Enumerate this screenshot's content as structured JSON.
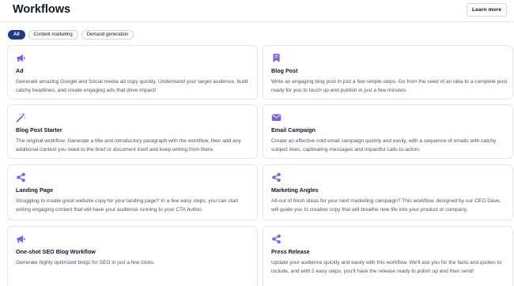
{
  "header": {
    "title": "Workflows",
    "learn_more": "Learn more"
  },
  "filters": [
    "All",
    "Content marketing",
    "Demand generation"
  ],
  "accent_color": "#7c5cf2",
  "workflows": [
    {
      "icon": "megaphone-icon",
      "title": "Ad",
      "description": "Generate amazing Google and Social media ad copy quickly. Understand your target audience, build catchy headlines, and create engaging ads that drive impact!"
    },
    {
      "icon": "bookmark-icon",
      "title": "Blog Post",
      "description": "Write an engaging blog post in just a few simple steps. Go from the seed of an idea to a complete post ready for you to touch up and publish in just a few minutes."
    },
    {
      "icon": "magic-wand-icon",
      "title": "Blog Post Starter",
      "description": "The original workflow. Generate a title and introductory paragraph with the workflow, then add any additional context you need to the brief or document itself and keep writing from there."
    },
    {
      "icon": "envelope-icon",
      "title": "Email Campaign",
      "description": "Create an effective cold email campaign quickly and easily, with a sequence of emails with catchy subject lines, captivating messages and impactful calls-to-action."
    },
    {
      "icon": "share-icon",
      "title": "Landing Page",
      "description": "Struggling to create great website copy for your landing page? In a few easy steps, you can start writing engaging content that will have your audience running to your CTA button."
    },
    {
      "icon": "share-icon",
      "title": "Marketing Angles",
      "description": "All-out of fresh ideas for your next marketing campaign? This workflow, designed by our CEO Dave, will guide you to creative copy that will breathe new life into your product or company."
    },
    {
      "icon": "megaphone-icon",
      "title": "One-shot SEO Blog Workflow",
      "description": "Generate highly optimized blogs for SEO in just a few clicks."
    },
    {
      "icon": "share-icon",
      "title": "Press Release",
      "description": "Update your audience quickly and easily with this workflow. We'll ask you for the facts and quotes to include, and with 2 easy steps, you'll have the release ready to polish up and then send!"
    }
  ]
}
